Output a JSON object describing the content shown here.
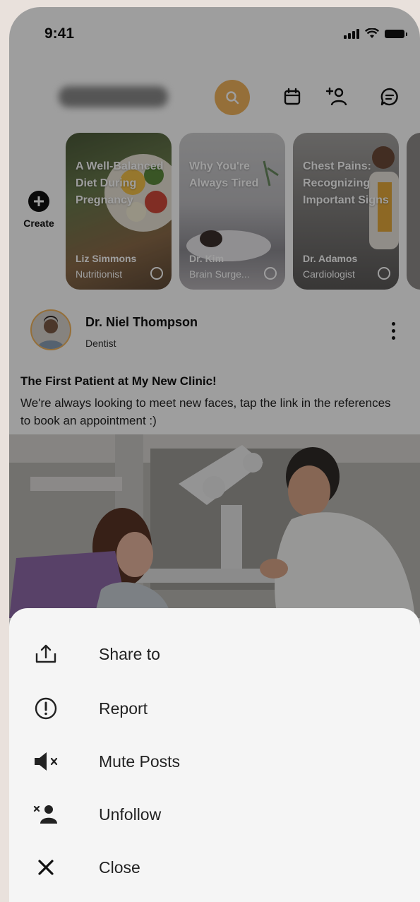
{
  "status_bar": {
    "time": "9:41"
  },
  "top_bar": {
    "icons": [
      "search-icon",
      "calendar-icon",
      "add-friend-icon",
      "chat-icon"
    ],
    "accent_color": "#f0b35c"
  },
  "stories": {
    "create_label": "Create",
    "items": [
      {
        "title": "A Well-Balanced Diet During Pregnancy",
        "author": "Liz Simmons",
        "role": "Nutritionist"
      },
      {
        "title": "Why You're Always Tired",
        "author": "Dr. Kim",
        "role": "Brain Surge..."
      },
      {
        "title": "Chest Pains: Recognizing Important Signs",
        "author": "Dr. Adamos",
        "role": "Cardiologist"
      }
    ]
  },
  "post": {
    "author": "Dr. Niel Thompson",
    "role": "Dentist",
    "title": "The First Patient at My New Clinic!",
    "body": "We're always looking to meet new faces, tap the link in the references to book an appointment :)"
  },
  "action_sheet": {
    "items": [
      {
        "label": "Share to",
        "icon": "share-icon"
      },
      {
        "label": "Report",
        "icon": "report-icon"
      },
      {
        "label": "Mute Posts",
        "icon": "mute-icon"
      },
      {
        "label": "Unfollow",
        "icon": "unfollow-icon"
      },
      {
        "label": "Close",
        "icon": "close-icon"
      }
    ]
  }
}
